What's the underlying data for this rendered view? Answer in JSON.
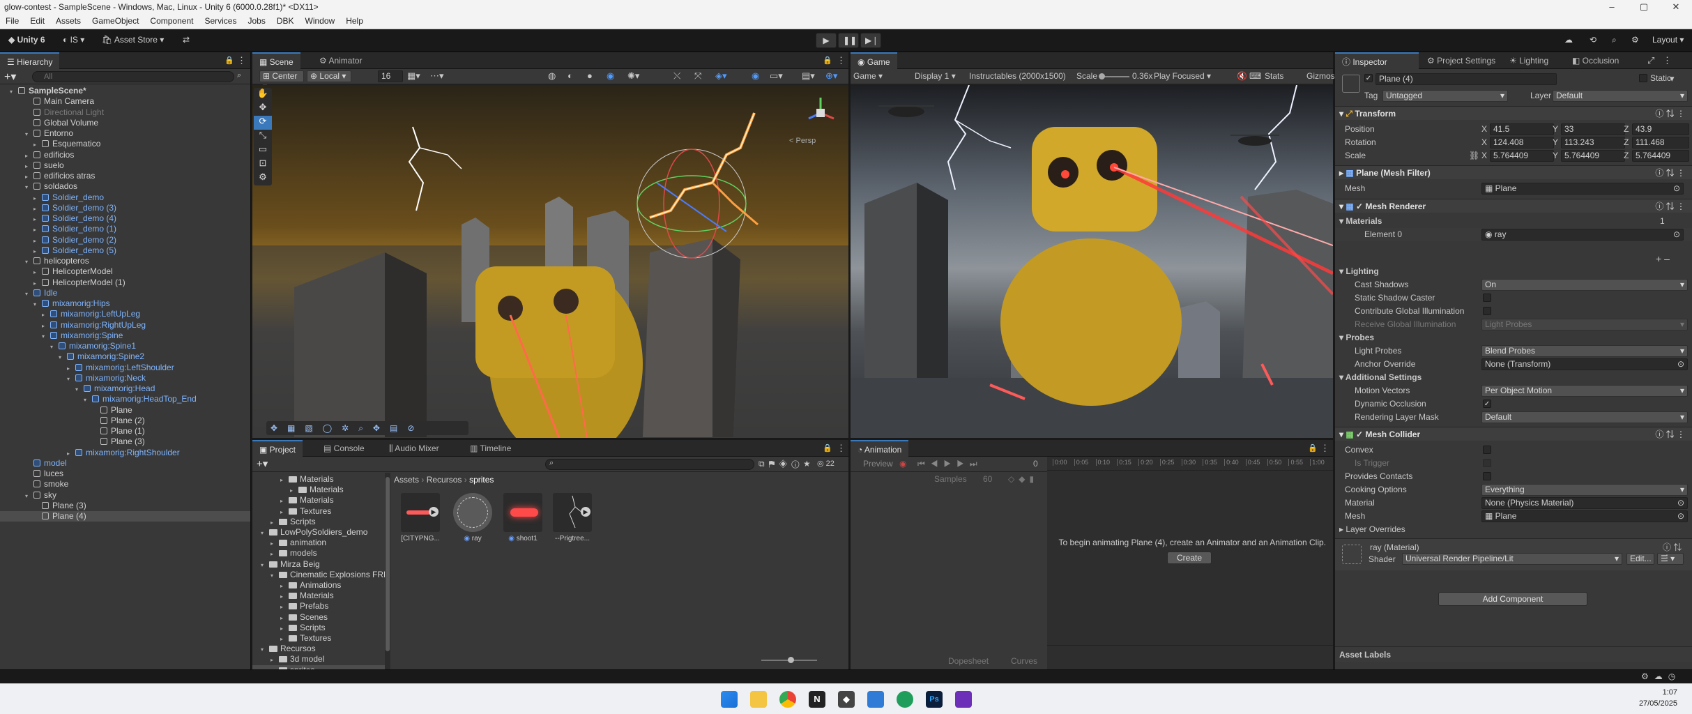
{
  "titlebar": {
    "title": "glow-contest - SampleScene - Windows, Mac, Linux - Unity 6 (6000.0.28f1)* <DX11>"
  },
  "menu": [
    "File",
    "Edit",
    "Assets",
    "GameObject",
    "Component",
    "Services",
    "Jobs",
    "DBK",
    "Window",
    "Help"
  ],
  "toolbar": {
    "account": "Unity 6",
    "is": "IS",
    "asset_store": "Asset Store",
    "layout": "Layout"
  },
  "hierarchy": {
    "tab": "Hierarchy",
    "search_placeholder": "All",
    "rows": [
      {
        "label": "SampleScene*",
        "indent": 0,
        "style": "scene",
        "arrow": "▾"
      },
      {
        "label": "Main Camera",
        "indent": 1,
        "style": "",
        "arrow": ""
      },
      {
        "label": "Directional Light",
        "indent": 1,
        "style": "grey",
        "arrow": ""
      },
      {
        "label": "Global Volume",
        "indent": 1,
        "style": "",
        "arrow": ""
      },
      {
        "label": "Entorno",
        "indent": 1,
        "style": "",
        "arrow": "▾"
      },
      {
        "label": "Esquematico",
        "indent": 2,
        "style": "",
        "arrow": "▸"
      },
      {
        "label": "edificios",
        "indent": 1,
        "style": "",
        "arrow": "▸"
      },
      {
        "label": "suelo",
        "indent": 1,
        "style": "",
        "arrow": "▸"
      },
      {
        "label": "edificios atras",
        "indent": 1,
        "style": "",
        "arrow": "▸"
      },
      {
        "label": "soldados",
        "indent": 1,
        "style": "",
        "arrow": "▾"
      },
      {
        "label": "Soldier_demo",
        "indent": 2,
        "style": "blue",
        "arrow": "▸"
      },
      {
        "label": "Soldier_demo (3)",
        "indent": 2,
        "style": "blue",
        "arrow": "▸"
      },
      {
        "label": "Soldier_demo (4)",
        "indent": 2,
        "style": "blue",
        "arrow": "▸"
      },
      {
        "label": "Soldier_demo (1)",
        "indent": 2,
        "style": "blue",
        "arrow": "▸"
      },
      {
        "label": "Soldier_demo (2)",
        "indent": 2,
        "style": "blue",
        "arrow": "▸"
      },
      {
        "label": "Soldier_demo (5)",
        "indent": 2,
        "style": "blue",
        "arrow": "▸"
      },
      {
        "label": "helicopteros",
        "indent": 1,
        "style": "",
        "arrow": "▾"
      },
      {
        "label": "HelicopterModel",
        "indent": 2,
        "style": "",
        "arrow": "▸"
      },
      {
        "label": "HelicopterModel (1)",
        "indent": 2,
        "style": "",
        "arrow": "▸"
      },
      {
        "label": "Idle",
        "indent": 1,
        "style": "blue",
        "arrow": "▾"
      },
      {
        "label": "mixamorig:Hips",
        "indent": 2,
        "style": "blue",
        "arrow": "▾"
      },
      {
        "label": "mixamorig:LeftUpLeg",
        "indent": 3,
        "style": "blue",
        "arrow": "▸"
      },
      {
        "label": "mixamorig:RightUpLeg",
        "indent": 3,
        "style": "blue",
        "arrow": "▸"
      },
      {
        "label": "mixamorig:Spine",
        "indent": 3,
        "style": "blue",
        "arrow": "▾"
      },
      {
        "label": "mixamorig:Spine1",
        "indent": 4,
        "style": "blue",
        "arrow": "▾"
      },
      {
        "label": "mixamorig:Spine2",
        "indent": 5,
        "style": "blue",
        "arrow": "▾"
      },
      {
        "label": "mixamorig:LeftShoulder",
        "indent": 6,
        "style": "blue",
        "arrow": "▸"
      },
      {
        "label": "mixamorig:Neck",
        "indent": 6,
        "style": "blue",
        "arrow": "▾"
      },
      {
        "label": "mixamorig:Head",
        "indent": 7,
        "style": "blue",
        "arrow": "▾"
      },
      {
        "label": "mixamorig:HeadTop_End",
        "indent": 8,
        "style": "blue",
        "arrow": "▾"
      },
      {
        "label": "Plane",
        "indent": 9,
        "style": "",
        "arrow": ""
      },
      {
        "label": "Plane (2)",
        "indent": 9,
        "style": "",
        "arrow": ""
      },
      {
        "label": "Plane (1)",
        "indent": 9,
        "style": "",
        "arrow": ""
      },
      {
        "label": "Plane (3)",
        "indent": 9,
        "style": "",
        "arrow": ""
      },
      {
        "label": "mixamorig:RightShoulder",
        "indent": 6,
        "style": "blue",
        "arrow": "▸"
      },
      {
        "label": "model",
        "indent": 1,
        "style": "blue",
        "arrow": ""
      },
      {
        "label": "luces",
        "indent": 1,
        "style": "",
        "arrow": ""
      },
      {
        "label": "smoke",
        "indent": 1,
        "style": "",
        "arrow": ""
      },
      {
        "label": "sky",
        "indent": 1,
        "style": "",
        "arrow": "▾"
      },
      {
        "label": "Plane (3)",
        "indent": 2,
        "style": "",
        "arrow": ""
      },
      {
        "label": "Plane (4)",
        "indent": 2,
        "style": "sel",
        "arrow": ""
      }
    ]
  },
  "scene": {
    "tab1": "Scene",
    "tab2": "Animator",
    "pivot": "Center",
    "space": "Local",
    "grid": "16",
    "persp": "< Persp"
  },
  "game": {
    "tab": "Game",
    "mode": "Game",
    "display": "Display 1",
    "resolution": "Instructables (2000x1500)",
    "scale_label": "Scale",
    "scale_value": "0.36x",
    "play": "Play Focused",
    "stats": "Stats",
    "gizmos": "Gizmos"
  },
  "project": {
    "tab1": "Project",
    "tab2": "Console",
    "tab3": "Audio Mixer",
    "tab4": "Timeline",
    "breadcrumb": [
      "Assets",
      "Recursos",
      "sprites"
    ],
    "count": "22",
    "tree": [
      {
        "label": "Materials",
        "indent": 3,
        "open": false
      },
      {
        "label": "Materials",
        "indent": 4,
        "open": false
      },
      {
        "label": "Materials",
        "indent": 3,
        "open": false
      },
      {
        "label": "Textures",
        "indent": 3,
        "open": false
      },
      {
        "label": "Scripts",
        "indent": 2,
        "open": false
      },
      {
        "label": "LowPolySoldiers_demo",
        "indent": 1,
        "open": true
      },
      {
        "label": "animation",
        "indent": 2,
        "open": false
      },
      {
        "label": "models",
        "indent": 2,
        "open": false
      },
      {
        "label": "Mirza Beig",
        "indent": 1,
        "open": true
      },
      {
        "label": "Cinematic Explosions FREE",
        "indent": 2,
        "open": true
      },
      {
        "label": "Animations",
        "indent": 3,
        "open": false
      },
      {
        "label": "Materials",
        "indent": 3,
        "open": false
      },
      {
        "label": "Prefabs",
        "indent": 3,
        "open": false
      },
      {
        "label": "Scenes",
        "indent": 3,
        "open": false
      },
      {
        "label": "Scripts",
        "indent": 3,
        "open": false
      },
      {
        "label": "Textures",
        "indent": 3,
        "open": false
      },
      {
        "label": "Recursos",
        "indent": 1,
        "open": true
      },
      {
        "label": "3d model",
        "indent": 2,
        "open": false
      },
      {
        "label": "sprites",
        "indent": 2,
        "open": false
      }
    ],
    "assets": [
      "[CITYPNG...",
      "ray",
      "shoot1",
      "--Prigtree..."
    ]
  },
  "animation": {
    "tab": "Animation",
    "preview": "Preview",
    "frame": "0",
    "samples_label": "Samples",
    "samples": "60",
    "message": "To begin animating Plane (4), create an Animator and an Animation Clip.",
    "create": "Create",
    "dopesheet": "Dopesheet",
    "curves": "Curves",
    "ticks": [
      "0:00",
      "0:05",
      "0:10",
      "0:15",
      "0:20",
      "0:25",
      "0:30",
      "0:35",
      "0:40",
      "0:45",
      "0:50",
      "0:55",
      "1:00"
    ]
  },
  "inspector": {
    "tabs": [
      "Inspector",
      "Project Settings",
      "Lighting",
      "Occlusion"
    ],
    "name": "Plane (4)",
    "static": "Static",
    "tag_label": "Tag",
    "tag": "Untagged",
    "layer_label": "Layer",
    "layer": "Default",
    "transform": {
      "title": "Transform",
      "position_label": "Position",
      "rotation_label": "Rotation",
      "scale_label": "Scale",
      "position": [
        "41.5",
        "33",
        "43.9"
      ],
      "rotation": [
        "124.408",
        "113.243",
        "111.468"
      ],
      "scale": [
        "5.764409",
        "5.764409",
        "5.764409"
      ]
    },
    "mesh_filter": {
      "title": "Plane (Mesh Filter)",
      "mesh_label": "Mesh",
      "mesh": "Plane"
    },
    "mesh_renderer": {
      "title": "Mesh Renderer",
      "materials_label": "Materials",
      "materials_count": "1",
      "element0_label": "Element 0",
      "element0": "ray",
      "lighting": "Lighting",
      "cast_shadows_label": "Cast Shadows",
      "cast_shadows": "On",
      "static_shadow": "Static Shadow Caster",
      "contribute_gi": "Contribute Global Illumination",
      "receive_gi_label": "Receive Global Illumination",
      "receive_gi": "Light Probes",
      "probes": "Probes",
      "light_probes_label": "Light Probes",
      "light_probes": "Blend Probes",
      "anchor_label": "Anchor Override",
      "anchor": "None (Transform)",
      "additional": "Additional Settings",
      "motion_label": "Motion Vectors",
      "motion": "Per Object Motion",
      "dynamic_occ": "Dynamic Occlusion",
      "render_layer_label": "Rendering Layer Mask",
      "render_layer": "Default"
    },
    "mesh_collider": {
      "title": "Mesh Collider",
      "convex": "Convex",
      "is_trigger": "Is Trigger",
      "provides_contacts": "Provides Contacts",
      "cooking_label": "Cooking Options",
      "cooking": "Everything",
      "material_label": "Material",
      "material": "None (Physics Material)",
      "mesh_label": "Mesh",
      "mesh": "Plane",
      "layer_overrides": "Layer Overrides"
    },
    "material": {
      "title": "ray (Material)",
      "shader_label": "Shader",
      "shader": "Universal Render Pipeline/Lit",
      "edit": "Edit..."
    },
    "add_component": "Add Component",
    "asset_labels": "Asset Labels"
  },
  "taskbar": {
    "time": "1:07",
    "date": "27/05/2025"
  }
}
